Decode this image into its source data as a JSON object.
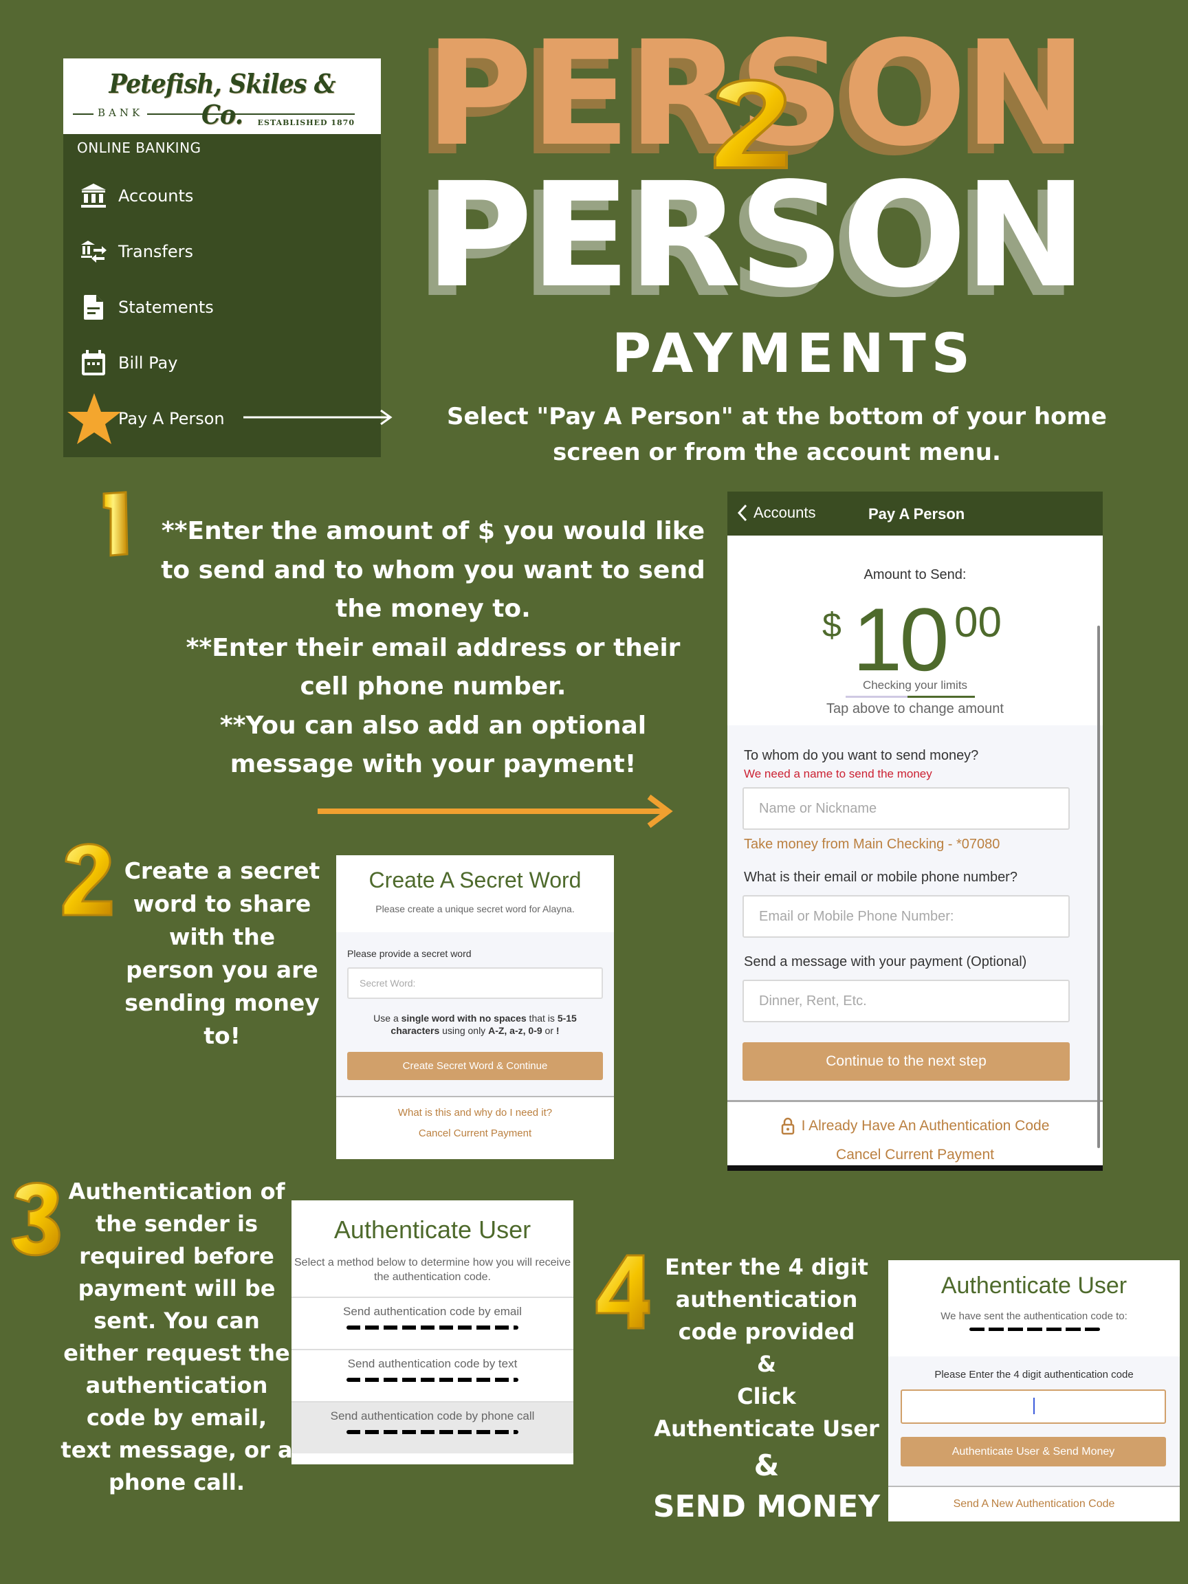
{
  "colors": {
    "background": "#556832",
    "menu_panel": "#3a4c22",
    "title_orange": "#e3a066",
    "accent_orange": "#f0a030",
    "button_tan": "#d1a06a",
    "link_tan": "#bb8040",
    "brand_green": "#4e6a2c",
    "error_red": "#cc2233"
  },
  "bank_menu": {
    "logo": {
      "name": "Petefish, Skiles & Co.",
      "bank": "BANK",
      "established": "ESTABLISHED 1870"
    },
    "heading": "ONLINE BANKING",
    "items": [
      {
        "label": "Accounts",
        "icon": "bank-icon"
      },
      {
        "label": "Transfers",
        "icon": "transfer-icon"
      },
      {
        "label": "Statements",
        "icon": "document-icon"
      },
      {
        "label": "Bill Pay",
        "icon": "calendar-icon"
      },
      {
        "label": "Pay A Person",
        "icon": "star-icon"
      }
    ]
  },
  "title": {
    "line1": "PERSON",
    "connector": "2",
    "line2": "PERSON",
    "subtitle": "PAYMENTS"
  },
  "intro": "Select \"Pay A Person\" at the bottom of your home screen or from the account menu.",
  "steps": {
    "step1": {
      "number": "1",
      "lines": [
        "**Enter the amount of $ you would like to send and to whom you want to send the money to.",
        "**Enter their email address or their cell phone number.",
        "**You can also add an optional message with your payment!"
      ]
    },
    "step2": {
      "number": "2",
      "text": "Create a secret word to share with the person you are sending money to!"
    },
    "step3": {
      "number": "3",
      "text": "Authentication of the sender is required before payment will be sent.  You can either request the authentication code by email, text message, or a phone call."
    },
    "step4": {
      "number": "4",
      "text": "Enter the 4 digit authentication code provided",
      "amp1": "&",
      "click": "Click",
      "action": "Authenticate User",
      "amp2": "&",
      "final": "SEND MONEY"
    }
  },
  "pay_screen": {
    "back_label": "Accounts",
    "title": "Pay A Person",
    "amount_label": "Amount to Send:",
    "currency": "$",
    "amount_whole": "10",
    "amount_cents": "00",
    "checking_label": "Checking your limits",
    "limit_check_progress": 0.52,
    "tap_hint": "Tap above to change amount",
    "recipient_label": "To whom do you want to send money?",
    "recipient_error": "We need a name to send the money",
    "recipient_placeholder": "Name or Nickname",
    "recipient_value": "",
    "source_account": "Take money from Main Checking - *07080",
    "contact_label": "What is their email or mobile phone number?",
    "contact_placeholder": "Email or Mobile Phone Number:",
    "contact_value": "",
    "message_label": "Send a message with your payment (Optional)",
    "message_placeholder": "Dinner, Rent, Etc.",
    "message_value": "",
    "continue_button": "Continue to the next step",
    "auth_code_link": "I Already Have An Authentication Code",
    "cancel_link": "Cancel Current Payment"
  },
  "secret_screen": {
    "title": "Create A Secret Word",
    "subtitle": "Please create a unique secret word for Alayna.",
    "field_label": "Please provide a secret word",
    "placeholder": "Secret Word:",
    "value": "",
    "hint": {
      "p1": "Use a ",
      "b1": "single word with no spaces",
      "p2": " that is ",
      "b2": "5-15 characters",
      "p3": " using only ",
      "b3": "A-Z, a-z, 0-9",
      "p4": " or ",
      "b4": "!"
    },
    "button": "Create Secret Word & Continue",
    "help_link": "What is this and why do I need it?",
    "cancel_link": "Cancel Current Payment"
  },
  "auth_method_screen": {
    "title": "Authenticate User",
    "subtitle": "Select a method below to determine how you will receive the authentication code.",
    "options": [
      {
        "label": "Send authentication code by email"
      },
      {
        "label": "Send authentication code by text"
      },
      {
        "label": "Send authentication code by phone call"
      }
    ]
  },
  "auth_code_screen": {
    "title": "Authenticate User",
    "subtitle": "We have sent the authentication code to:",
    "field_label": "Please Enter the 4 digit authentication code",
    "value": "",
    "button": "Authenticate User & Send Money",
    "resend_link": "Send A New Authentication Code"
  }
}
